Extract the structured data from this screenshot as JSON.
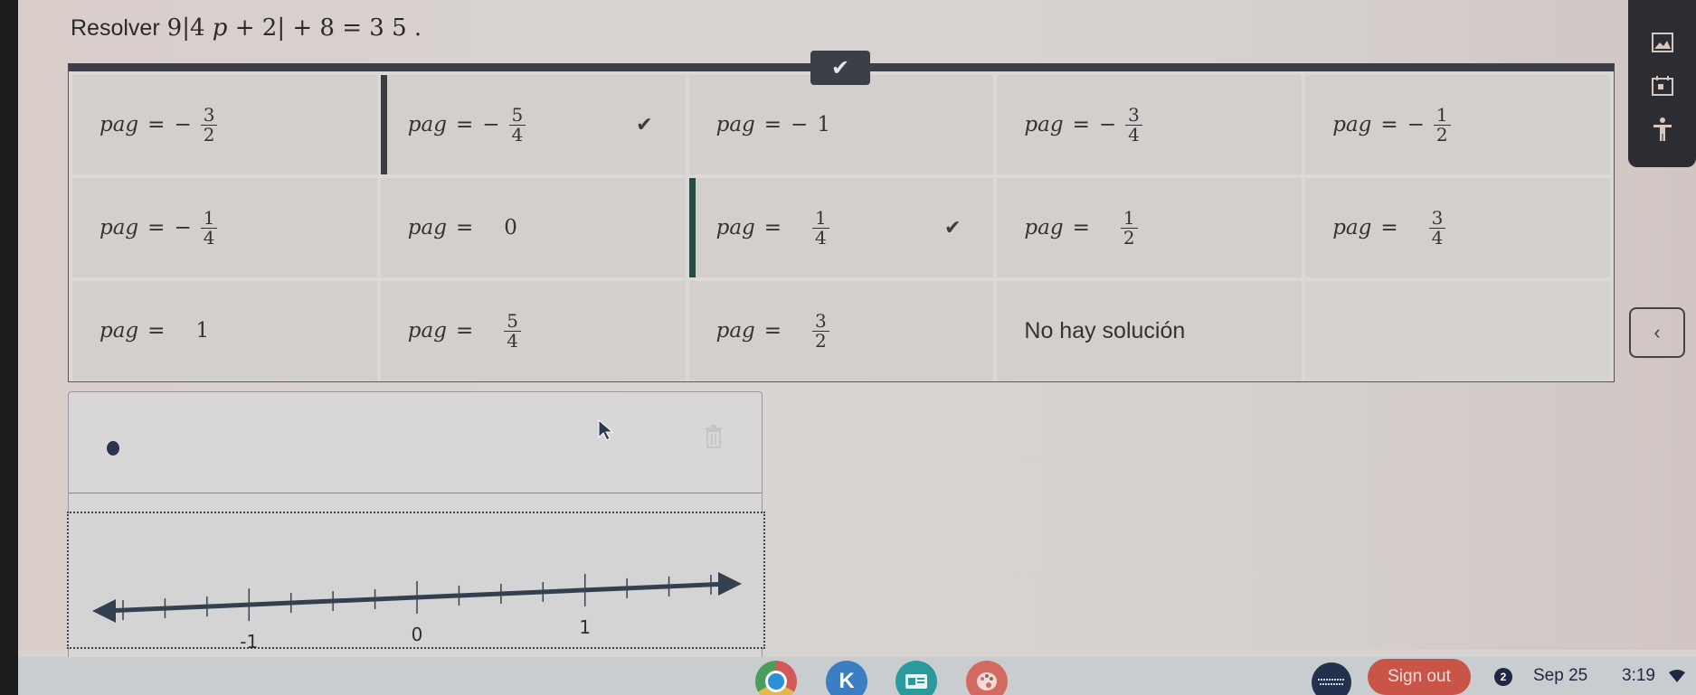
{
  "question": {
    "prefix": "Resolver",
    "equation_parts": {
      "coef": "9",
      "abs_open": "|",
      "inner_coef": "4",
      "variable": "p",
      "plus1": "+",
      "inner_const": "2",
      "abs_close": "|",
      "plus2": "+",
      "const": "8",
      "equals": "=",
      "rhs": "3 5",
      "period": "."
    }
  },
  "check_tab": {
    "icon": "check-icon",
    "glyph": "✔"
  },
  "options": [
    {
      "var": "pag",
      "eq": "=",
      "sign": "−",
      "num": "3",
      "den": "2",
      "selected": false
    },
    {
      "var": "pag",
      "eq": "=",
      "sign": "−",
      "num": "5",
      "den": "4",
      "selected": true,
      "checked": "✔"
    },
    {
      "var": "pag",
      "eq": "=",
      "sign": "−",
      "whole": "1",
      "selected": false
    },
    {
      "var": "pag",
      "eq": "=",
      "sign": "−",
      "num": "3",
      "den": "4",
      "selected": false
    },
    {
      "var": "pag",
      "eq": "=",
      "sign": "−",
      "num": "1",
      "den": "2",
      "selected": false
    },
    {
      "var": "pag",
      "eq": "=",
      "sign": "−",
      "num": "1",
      "den": "4",
      "selected": false
    },
    {
      "var": "pag",
      "eq": "=",
      "sign": "",
      "whole": "0",
      "selected": false
    },
    {
      "var": "pag",
      "eq": "=",
      "sign": "",
      "num": "1",
      "den": "4",
      "selected": true,
      "checked": "✔"
    },
    {
      "var": "pag",
      "eq": "=",
      "sign": "",
      "num": "1",
      "den": "2",
      "selected": false
    },
    {
      "var": "pag",
      "eq": "=",
      "sign": "",
      "num": "3",
      "den": "4",
      "selected": false
    },
    {
      "var": "pag",
      "eq": "=",
      "sign": "",
      "whole": "1",
      "selected": false
    },
    {
      "var": "pag",
      "eq": "=",
      "sign": "",
      "num": "5",
      "den": "4",
      "selected": false
    },
    {
      "var": "pag",
      "eq": "=",
      "sign": "",
      "num": "3",
      "den": "2",
      "selected": false
    },
    {
      "text": "No hay solución",
      "selected": false
    }
  ],
  "side_panel": {
    "icons": [
      {
        "name": "image-tool-icon",
        "glyph": "▣"
      },
      {
        "name": "calendar-icon",
        "glyph": "▦"
      },
      {
        "name": "accessibility-icon",
        "glyph": "♙"
      }
    ]
  },
  "collapse_button": {
    "glyph": "‹"
  },
  "answer_box": {
    "trash_glyph": "🗑"
  },
  "number_line": {
    "min": -1.75,
    "max": 1.75,
    "tick_step": 0.25,
    "labels": [
      {
        "value": -1,
        "text": "-1"
      },
      {
        "value": 0,
        "text": "0"
      },
      {
        "value": 1,
        "text": "1"
      }
    ],
    "color": "#34404f"
  },
  "taskbar": {
    "apps": [
      {
        "name": "chrome",
        "label": ""
      },
      {
        "name": "kami",
        "label": "K"
      },
      {
        "name": "classroom-app",
        "label": "▪≡"
      },
      {
        "name": "paint-app",
        "label": "🎨"
      }
    ],
    "avatar_text": "",
    "sign_out_label": "Sign out",
    "notification_count": "2",
    "date": "Sep 25",
    "time": "3:19"
  },
  "colors": {
    "selected_border": "#3a3d44",
    "sign_out_bg": "#c95548",
    "header_bar": "#3c3f47"
  }
}
